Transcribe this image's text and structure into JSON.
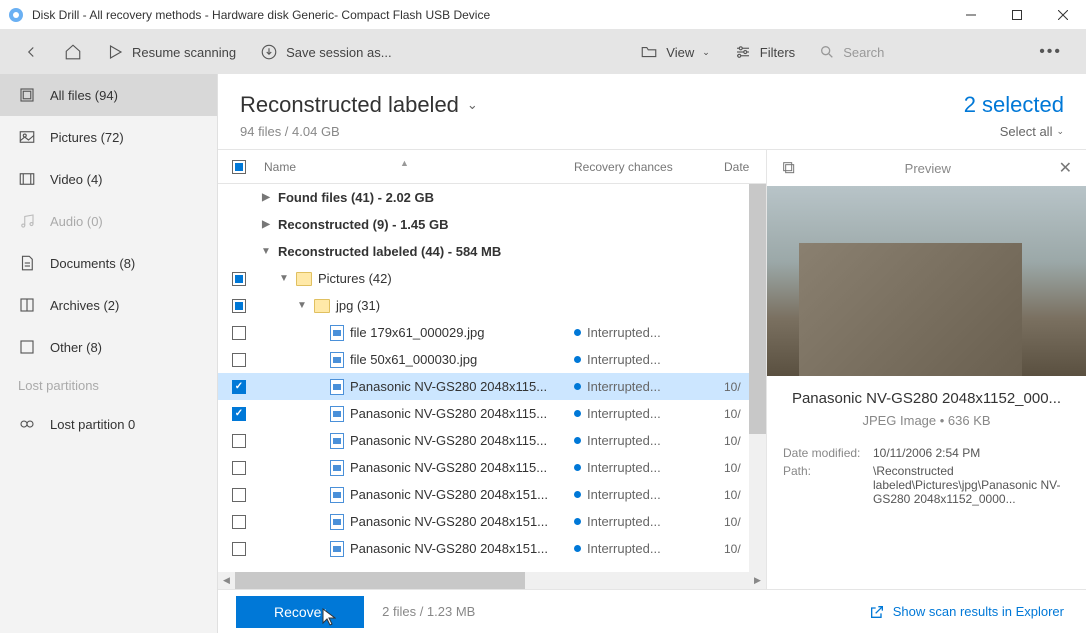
{
  "window": {
    "title": "Disk Drill - All recovery methods - Hardware disk Generic- Compact Flash USB Device"
  },
  "toolbar": {
    "resume": "Resume scanning",
    "save_session": "Save session as...",
    "view": "View",
    "filters": "Filters",
    "search_placeholder": "Search"
  },
  "sidebar": {
    "items": [
      {
        "label": "All files (94)",
        "icon": "all-files-icon",
        "active": true
      },
      {
        "label": "Pictures (72)",
        "icon": "pictures-icon"
      },
      {
        "label": "Video (4)",
        "icon": "video-icon"
      },
      {
        "label": "Audio (0)",
        "icon": "audio-icon",
        "muted": true
      },
      {
        "label": "Documents (8)",
        "icon": "documents-icon"
      },
      {
        "label": "Archives (2)",
        "icon": "archives-icon"
      },
      {
        "label": "Other (8)",
        "icon": "other-icon"
      }
    ],
    "lost_partitions_label": "Lost partitions",
    "lost_partition_item": "Lost partition 0"
  },
  "header": {
    "title": "Reconstructed labeled",
    "subtitle": "94 files / 4.04 GB",
    "selected": "2 selected",
    "select_all": "Select all"
  },
  "columns": {
    "name": "Name",
    "recovery": "Recovery chances",
    "date": "Date"
  },
  "groups": [
    {
      "label": "Found files (41) - 2.02 GB",
      "expanded": false
    },
    {
      "label": "Reconstructed (9) - 1.45 GB",
      "expanded": false
    },
    {
      "label": "Reconstructed labeled (44) - 584 MB",
      "expanded": true
    }
  ],
  "folders": {
    "pictures": "Pictures (42)",
    "jpg": "jpg (31)"
  },
  "files": [
    {
      "name": "file 179x61_000029.jpg",
      "recovery": "Interrupted...",
      "date": "",
      "checked": false
    },
    {
      "name": "file 50x61_000030.jpg",
      "recovery": "Interrupted...",
      "date": "",
      "checked": false
    },
    {
      "name": "Panasonic NV-GS280 2048x115...",
      "recovery": "Interrupted...",
      "date": "10/",
      "checked": true,
      "selected": true
    },
    {
      "name": "Panasonic NV-GS280 2048x115...",
      "recovery": "Interrupted...",
      "date": "10/",
      "checked": true
    },
    {
      "name": "Panasonic NV-GS280 2048x115...",
      "recovery": "Interrupted...",
      "date": "10/",
      "checked": false
    },
    {
      "name": "Panasonic NV-GS280 2048x115...",
      "recovery": "Interrupted...",
      "date": "10/",
      "checked": false
    },
    {
      "name": "Panasonic NV-GS280 2048x151...",
      "recovery": "Interrupted...",
      "date": "10/",
      "checked": false
    },
    {
      "name": "Panasonic NV-GS280 2048x151...",
      "recovery": "Interrupted...",
      "date": "10/",
      "checked": false
    },
    {
      "name": "Panasonic NV-GS280 2048x151...",
      "recovery": "Interrupted...",
      "date": "10/",
      "checked": false
    }
  ],
  "preview": {
    "title": "Preview",
    "filename": "Panasonic NV-GS280 2048x1152_000...",
    "filetype": "JPEG Image • 636 KB",
    "date_modified_k": "Date modified:",
    "date_modified_v": "10/11/2006 2:54 PM",
    "path_k": "Path:",
    "path_v": "\\Reconstructed labeled\\Pictures\\jpg\\Panasonic NV-GS280 2048x1152_0000..."
  },
  "footer": {
    "recover": "Recover",
    "info": "2 files / 1.23 MB",
    "explorer_link": "Show scan results in Explorer"
  }
}
